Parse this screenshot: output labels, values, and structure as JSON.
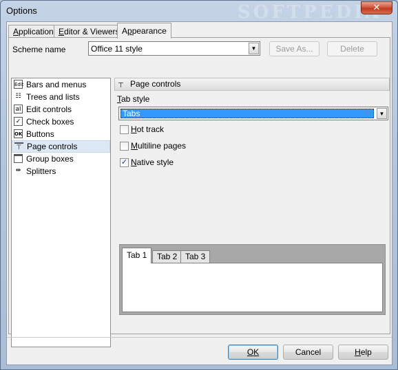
{
  "window": {
    "title": "Options",
    "close_label": "✕",
    "watermark": "SOFTPEDIA"
  },
  "tabs": [
    {
      "label_pre": "",
      "label_u": "A",
      "label_post": "pplication"
    },
    {
      "label_pre": "",
      "label_u": "E",
      "label_post": "ditor & Viewers"
    },
    {
      "label_pre": "A",
      "label_u": "p",
      "label_post": "pearance"
    }
  ],
  "scheme": {
    "label": "Scheme name",
    "value": "Office 11 style",
    "save_as_label": "Save As...",
    "delete_label": "Delete"
  },
  "categories": [
    {
      "label": "Bars and menus",
      "icon": "edit-icon"
    },
    {
      "label": "Trees and lists",
      "icon": "tree-icon"
    },
    {
      "label": "Edit controls",
      "icon": "text-cursor-icon"
    },
    {
      "label": "Check boxes",
      "icon": "checkbox-icon"
    },
    {
      "label": "Buttons",
      "icon": "ok-button-icon"
    },
    {
      "label": "Page controls",
      "icon": "tabs-icon",
      "selected": true
    },
    {
      "label": "Group boxes",
      "icon": "groupbox-icon"
    },
    {
      "label": "Splitters",
      "icon": "splitter-icon"
    }
  ],
  "panel": {
    "header": "Page controls",
    "tab_style_label_u": "T",
    "tab_style_label_rest": "ab style",
    "tab_style_value": "Tabs",
    "hot_track": {
      "label_pre": "",
      "label_u": "H",
      "label_post": "ot track",
      "checked": false
    },
    "multiline": {
      "label_pre": "",
      "label_u": "M",
      "label_post": "ultiline pages",
      "checked": false
    },
    "native": {
      "label_pre": "",
      "label_u": "N",
      "label_post": "ative style",
      "checked": true
    },
    "preview_tabs": [
      "Tab 1",
      "Tab 2",
      "Tab 3"
    ]
  },
  "footer": {
    "ok_label": "OK",
    "cancel_label": "Cancel",
    "help_label": "Help"
  },
  "colors": {
    "selection": "#3399ff",
    "accent_border": "#3c7fb1"
  }
}
